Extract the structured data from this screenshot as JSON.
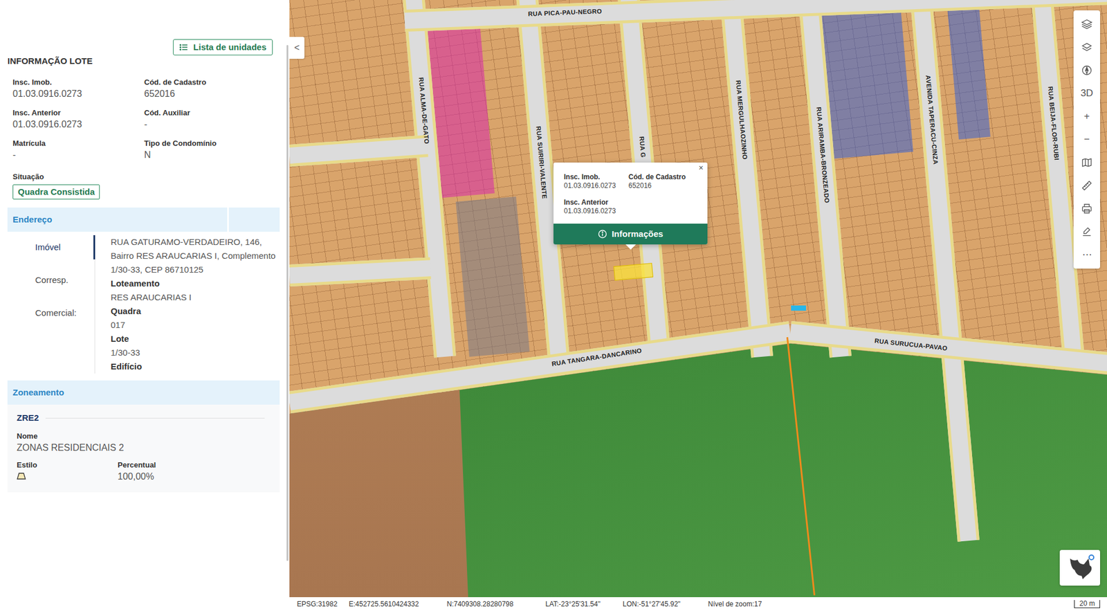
{
  "panel": {
    "units_button": "Lista de unidades",
    "title": "INFORMAÇÃO LOTE",
    "fields": [
      {
        "label": "Insc. Imob.",
        "value": "01.03.0916.0273"
      },
      {
        "label": "Cód. de Cadastro",
        "value": "652016"
      },
      {
        "label": "Insc. Anterior",
        "value": "01.03.0916.0273"
      },
      {
        "label": "Cód. Auxiliar",
        "value": "-"
      },
      {
        "label": "Matrícula",
        "value": "-"
      },
      {
        "label": "Tipo de Condomínio",
        "value": "N"
      }
    ],
    "situation": {
      "label": "Situação",
      "value": "Quadra Consistida"
    }
  },
  "address": {
    "title": "Endereço",
    "tabs": [
      {
        "label": "Imóvel",
        "selected": true
      },
      {
        "label": "Corresp.",
        "selected": false
      },
      {
        "label": "Comercial:",
        "selected": false
      }
    ],
    "text": "RUA GATURAMO-VERDADEIRO, 146, Bairro RES ARAUCARIAS I, Complemento 1/30-33, CEP 86710125",
    "details": [
      {
        "label": "Loteamento",
        "value": "RES ARAUCARIAS I"
      },
      {
        "label": "Quadra",
        "value": "017"
      },
      {
        "label": "Lote",
        "value": "1/30-33"
      },
      {
        "label": "Edifício"
      }
    ]
  },
  "zoning": {
    "title": "Zoneamento",
    "code": "ZRE2",
    "name_label": "Nome",
    "name": "ZONAS RESIDENCIAIS 2",
    "style_label": "Estilo",
    "percent_label": "Percentual",
    "percent": "100,00%"
  },
  "collapse_button": "<",
  "map": {
    "streets": [
      {
        "name": "RUA PICA-PAU-NEGRO"
      },
      {
        "name": "RUA ALMA-DE-GATO"
      },
      {
        "name": "RUA SUIRIRI-VALENTE"
      },
      {
        "name": "RUA G"
      },
      {
        "name": "RUA MERGULHAOZINHO"
      },
      {
        "name": "RUA ARIRAMBA-BRONZEADO"
      },
      {
        "name": "AVENIDA TAPERACU-CINZA"
      },
      {
        "name": "RUA BEIJA-FLOR-RUBI"
      },
      {
        "name": "RUA SURUCUA-PAVAO"
      },
      {
        "name": "RUA TANGARA-DANCARINO"
      }
    ],
    "popup": {
      "close": "×",
      "fields": [
        {
          "label": "Insc. Imob.",
          "value": "01.03.0916.0273"
        },
        {
          "label": "Cód. de Cadastro",
          "value": "652016"
        },
        {
          "label": "Insc. Anterior",
          "value": "01.03.0916.0273"
        }
      ],
      "button": "Informações"
    }
  },
  "toolbar": [
    {
      "kind": "icon"
    },
    {
      "kind": "icon"
    },
    {
      "kind": "icon"
    },
    {
      "kind": "text",
      "label": "3D"
    },
    {
      "kind": "text",
      "label": "+"
    },
    {
      "kind": "text",
      "label": "−"
    },
    {
      "kind": "icon"
    },
    {
      "kind": "icon"
    },
    {
      "kind": "icon"
    },
    {
      "kind": "icon"
    },
    {
      "kind": "text",
      "label": "⋯"
    }
  ],
  "status_bar": {
    "items": [
      "EPSG:31982",
      "E:452725.5610424332",
      "N:7409308.28280798",
      "LAT:-23°25'31.54\"",
      "LON:-51°27'45.92\"",
      "Nível de zoom:17"
    ],
    "scale": "20 m"
  }
}
